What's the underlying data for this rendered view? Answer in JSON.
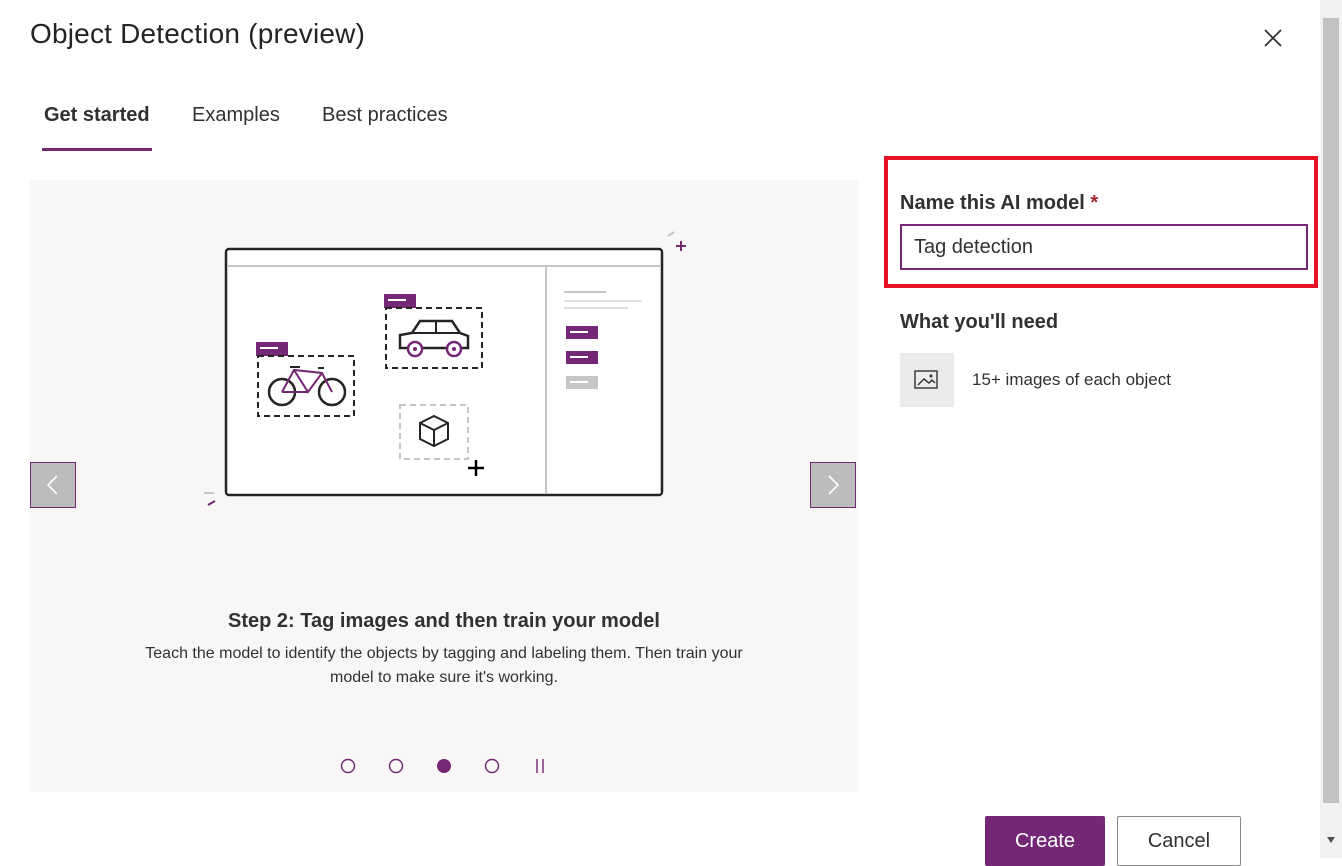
{
  "dialog": {
    "title": "Object Detection (preview)"
  },
  "tabs": [
    {
      "label": "Get started",
      "active": true
    },
    {
      "label": "Examples",
      "active": false
    },
    {
      "label": "Best practices",
      "active": false
    }
  ],
  "carousel": {
    "step_title": "Step 2: Tag images and then train your model",
    "step_description": "Teach the model to identify the objects by tagging and labeling them. Then train your model to make sure it's working.",
    "current_slide": 3,
    "total_slides": 4
  },
  "form": {
    "name_label": "Name this AI model",
    "required_marker": "*",
    "name_value": "Tag detection"
  },
  "requirements": {
    "heading": "What you'll need",
    "items": [
      {
        "icon": "image-icon",
        "text": "15+ images of each object"
      }
    ]
  },
  "footer": {
    "create_label": "Create",
    "cancel_label": "Cancel"
  },
  "colors": {
    "accent": "#742774",
    "highlight_border": "#e81123"
  }
}
